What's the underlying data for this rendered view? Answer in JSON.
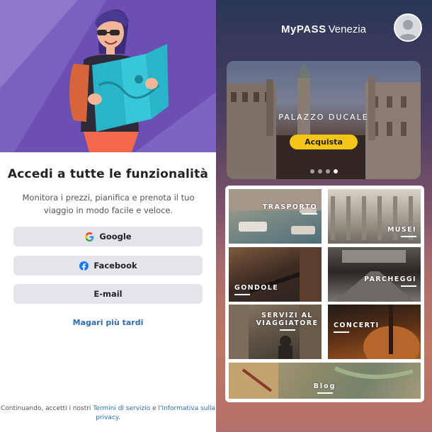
{
  "login": {
    "title": "Accedi a tutte le funzionalità",
    "subtitle": "Monitora i prezzi, pianifica e prenota il tuo viaggio in modo facile e veloce.",
    "buttons": {
      "google": "Google",
      "facebook": "Facebook",
      "email": "E-mail"
    },
    "later": "Magari più tardi",
    "terms_prefix": "Continuando, accetti i nostri",
    "terms_link": "Termini di servizio",
    "terms_and": "e l'",
    "privacy_link": "Informativa sulla privacy",
    "terms_suffix": "."
  },
  "app": {
    "brand_name": "MyPASS",
    "brand_city": "Venezia",
    "carousel": {
      "caption": "PALAZZO DUCALE",
      "buy_label": "Acquista",
      "slide_count": 4,
      "active_slide": 4
    },
    "tiles": [
      {
        "label": "TRASPORTO"
      },
      {
        "label": "MUSEI"
      },
      {
        "label": "GONDOLE"
      },
      {
        "label": "PARCHEGGI"
      },
      {
        "label": "SERVIZI AL VIAGGIATORE"
      },
      {
        "label": "CONCERTI"
      },
      {
        "label": "Blog"
      }
    ]
  },
  "colors": {
    "hero_purple": "#6c4fb3",
    "link_blue": "#2a6fb5",
    "button_gray": "#e3e5ea",
    "buy_yellow": "#f5c518",
    "google_blue": "#4285F4",
    "facebook_blue": "#1877F2"
  },
  "icons": {
    "google": "google-g-icon",
    "facebook": "facebook-icon",
    "avatar": "user-avatar-icon"
  }
}
